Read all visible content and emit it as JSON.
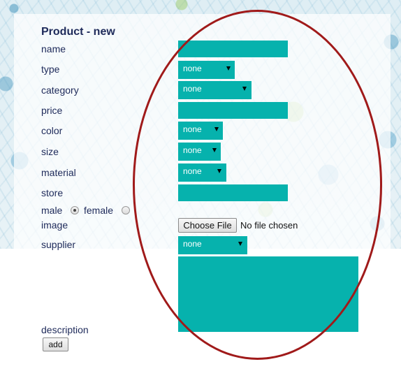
{
  "form": {
    "title": "Product - new",
    "labels": {
      "name": "name",
      "type": "type",
      "category": "category",
      "price": "price",
      "color": "color",
      "size": "size",
      "material": "material",
      "store": "store",
      "male": "male",
      "female": "female",
      "image": "image",
      "supplier": "supplier",
      "description": "description"
    },
    "selects": {
      "type": "none",
      "category": "none",
      "color": "none",
      "size": "none",
      "material": "none",
      "supplier": "none"
    },
    "gender_selected": "male",
    "file": {
      "button_label": "Choose File",
      "status": "No file chosen"
    },
    "submit_label": "add"
  },
  "colors": {
    "field_bg": "#06b2ad",
    "label_text": "#1e2a5a",
    "annotation_ellipse": "#a01a1a"
  }
}
